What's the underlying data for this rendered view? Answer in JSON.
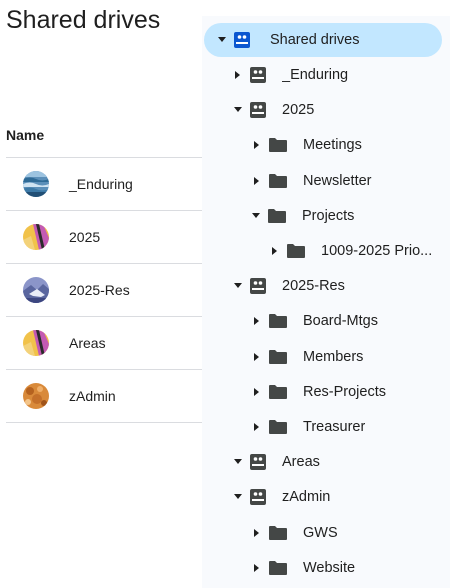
{
  "page": {
    "title": "Shared drives"
  },
  "list": {
    "header": "Name",
    "rows": [
      {
        "label": "_Enduring",
        "avatar": "ocean-waves-photo"
      },
      {
        "label": "2025",
        "avatar": "colorful-abstract"
      },
      {
        "label": "2025-Res",
        "avatar": "mountain-landscape-photo"
      },
      {
        "label": "Areas",
        "avatar": "colorful-abstract"
      },
      {
        "label": "zAdmin",
        "avatar": "orange-texture-photo"
      }
    ]
  },
  "tree": {
    "root": {
      "label": "Shared drives",
      "icon": "shared-drives-icon",
      "expanded": true,
      "selected": true
    },
    "items": [
      {
        "label": "_Enduring",
        "icon": "shared-drive-icon",
        "expanded": false
      },
      {
        "label": "2025",
        "icon": "shared-drive-icon",
        "expanded": true
      },
      {
        "label": "Meetings",
        "icon": "folder-icon",
        "expanded": false
      },
      {
        "label": "Newsletter",
        "icon": "folder-icon",
        "expanded": false
      },
      {
        "label": "Projects",
        "icon": "folder-icon",
        "expanded": true
      },
      {
        "label": "1009-2025 Prio...",
        "icon": "folder-icon",
        "expanded": false
      },
      {
        "label": "2025-Res",
        "icon": "shared-drive-icon",
        "expanded": true
      },
      {
        "label": "Board-Mtgs",
        "icon": "folder-icon",
        "expanded": false
      },
      {
        "label": "Members",
        "icon": "folder-icon",
        "expanded": false
      },
      {
        "label": "Res-Projects",
        "icon": "folder-icon",
        "expanded": false
      },
      {
        "label": "Treasurer",
        "icon": "folder-icon",
        "expanded": false
      },
      {
        "label": "Areas",
        "icon": "shared-drive-icon",
        "expanded": true
      },
      {
        "label": "zAdmin",
        "icon": "shared-drive-icon",
        "expanded": true
      },
      {
        "label": "GWS",
        "icon": "folder-icon",
        "expanded": false
      },
      {
        "label": "Website",
        "icon": "folder-icon",
        "expanded": false
      }
    ]
  },
  "colors": {
    "selected_bg": "#c2e7ff",
    "panel_bg": "#f8fafd",
    "icon": "#444746",
    "root_icon": "#0b57d0",
    "divider": "#dadce0"
  }
}
